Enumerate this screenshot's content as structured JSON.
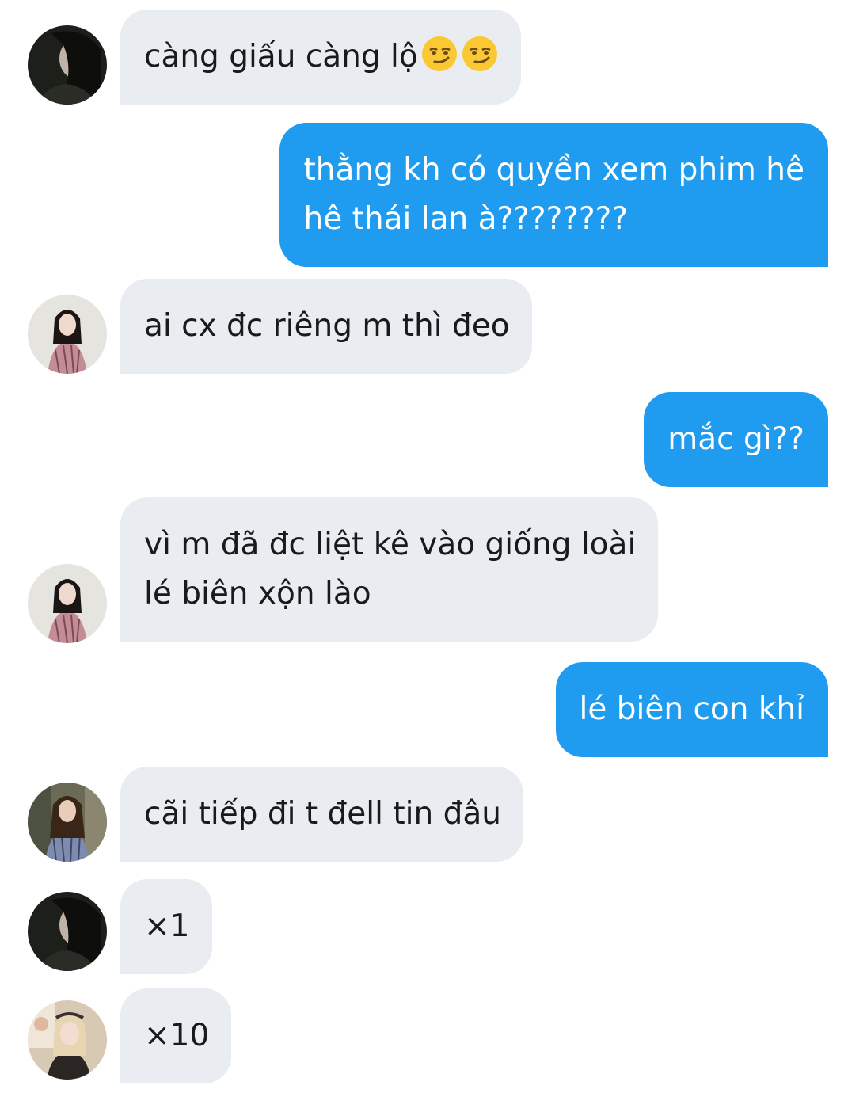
{
  "conversation": {
    "messages": [
      {
        "direction": "incoming",
        "avatar": "avatar-dark-hair-icon",
        "text": "càng giấu càng lộ",
        "emojis": [
          "smirking-face-icon",
          "smirking-face-icon"
        ]
      },
      {
        "direction": "outgoing",
        "lines": [
          "thằng kh có quyền xem phim hê",
          "hê thái lan à????????"
        ]
      },
      {
        "direction": "incoming",
        "avatar": "avatar-girl-plaid-icon",
        "text": "ai cx đc riêng m thì đeo"
      },
      {
        "direction": "outgoing",
        "text": "mắc gì??"
      },
      {
        "direction": "incoming",
        "avatar": "avatar-girl-plaid-icon",
        "lines": [
          "vì m đã đc liệt kê vào giống loài",
          "lé biên xộn lào"
        ]
      },
      {
        "direction": "outgoing",
        "text": "lé biên con khỉ"
      },
      {
        "direction": "incoming",
        "avatar": "avatar-girl-street-icon",
        "text": "cãi tiếp đi t đell tin đâu"
      },
      {
        "direction": "incoming",
        "avatar": "avatar-dark-hair-icon",
        "text": "×1"
      },
      {
        "direction": "incoming",
        "avatar": "avatar-blonde-girl-icon",
        "text": "×10"
      }
    ]
  },
  "colors": {
    "incoming_bubble": "#e9edf1",
    "outgoing_bubble": "#1f9bf0",
    "incoming_text": "#1a1a1a",
    "outgoing_text": "#ffffff"
  }
}
